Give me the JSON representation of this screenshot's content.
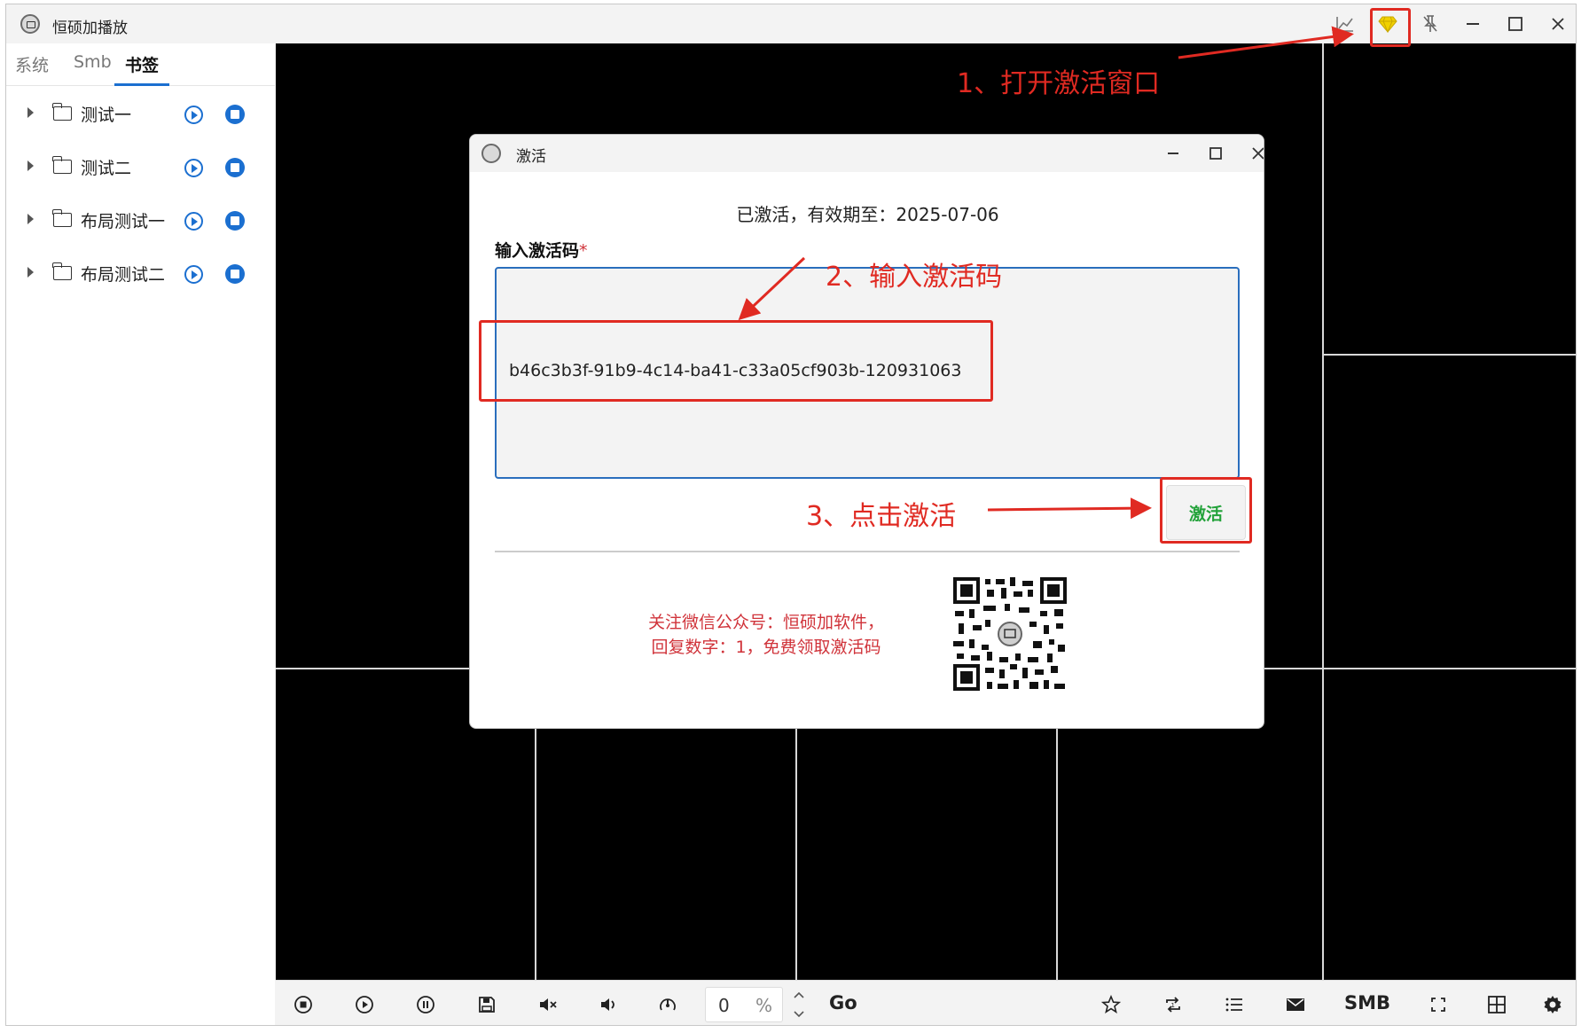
{
  "app": {
    "title": "恒硕加播放",
    "titlebar_icons": [
      "chart-icon",
      "diamond-icon",
      "pin-icon",
      "minimize-icon",
      "maximize-icon",
      "close-icon"
    ],
    "diamond_color": "#f1d100"
  },
  "sidebar": {
    "tabs": [
      {
        "label": "系统",
        "active": false
      },
      {
        "label": "Smb",
        "active": false
      },
      {
        "label": "书签",
        "active": true
      }
    ],
    "bookmarks": [
      {
        "label": "测试一"
      },
      {
        "label": "测试二"
      },
      {
        "label": "布局测试一"
      },
      {
        "label": "布局测试二"
      }
    ]
  },
  "bottombar": {
    "icons": [
      "stop-icon",
      "play-icon",
      "pause-icon",
      "save-icon",
      "mute-icon",
      "volume-icon",
      "speed-icon",
      "star-icon",
      "repeat-icon",
      "list-icon",
      "mail-icon",
      "fullscreen-icon",
      "grid-icon",
      "gear-icon"
    ],
    "number_value": "0",
    "number_unit": "%",
    "go_label": "Go",
    "smb_label": "SMB"
  },
  "dialog": {
    "title": "激活",
    "status": "已激活，有效期至：2025-07-06",
    "code_label": "输入激活码",
    "required_mark": "*",
    "code_value": "b46c3b3f-91b9-4c14-ba41-c33a05cf903b-120931063",
    "activate_label": "激活",
    "wechat_line1": "关注微信公众号：恒硕加软件，",
    "wechat_line2": "回复数字：1，免费领取激活码"
  },
  "annotations": {
    "step1": "1、打开激活窗口",
    "step2": "2、输入激活码",
    "step3": "3、点击激活",
    "color": "#e02a22"
  },
  "colors": {
    "accent": "#1b6fd0",
    "activate_text": "#23a23a",
    "wechat_text": "#d0333a"
  }
}
